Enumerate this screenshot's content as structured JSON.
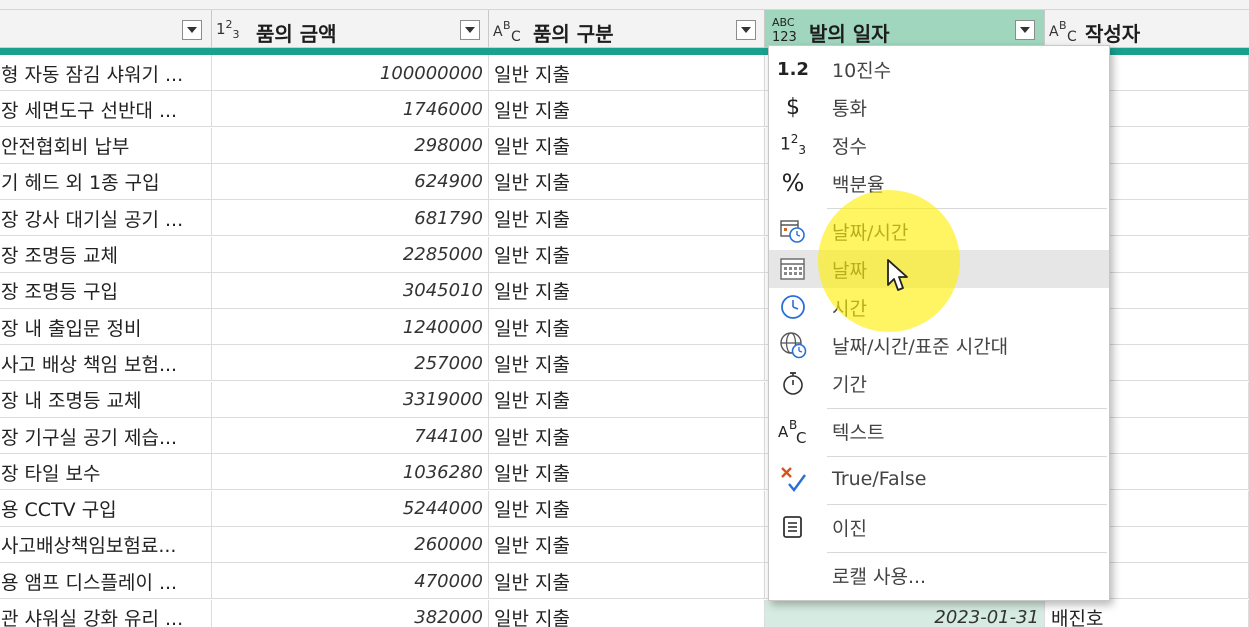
{
  "columns": {
    "amount": {
      "type_icon": "1²₃",
      "label": "품의 금액"
    },
    "category": {
      "type_icon": "ABC",
      "label": "품의 구분"
    },
    "order_date": {
      "type_icon": "ABC/123",
      "label": "발의 일자"
    },
    "author": {
      "type_icon": "ABC",
      "label": "작성자"
    }
  },
  "rows": [
    {
      "name": "형 자동 잠김 샤워기 ...",
      "amount": "100000000",
      "category": "일반 지출",
      "date": "",
      "author": ""
    },
    {
      "name": "장 세면도구 선반대 ...",
      "amount": "1746000",
      "category": "일반 지출",
      "date": "",
      "author": ""
    },
    {
      "name": "안전협회비 납부",
      "amount": "298000",
      "category": "일반 지출",
      "date": "",
      "author": ""
    },
    {
      "name": "기 헤드 외 1종 구입",
      "amount": "624900",
      "category": "일반 지출",
      "date": "",
      "author": ""
    },
    {
      "name": "장 강사 대기실 공기 ...",
      "amount": "681790",
      "category": "일반 지출",
      "date": "",
      "author": ""
    },
    {
      "name": "장 조명등 교체",
      "amount": "2285000",
      "category": "일반 지출",
      "date": "",
      "author": ""
    },
    {
      "name": "장 조명등 구입",
      "amount": "3045010",
      "category": "일반 지출",
      "date": "",
      "author": ""
    },
    {
      "name": "장 내 출입문 정비",
      "amount": "1240000",
      "category": "일반 지출",
      "date": "",
      "author": ""
    },
    {
      "name": " 사고 배상 책임 보험...",
      "amount": "257000",
      "category": "일반 지출",
      "date": "",
      "author": ""
    },
    {
      "name": "장 내 조명등 교체",
      "amount": "3319000",
      "category": "일반 지출",
      "date": "",
      "author": ""
    },
    {
      "name": "장 기구실 공기 제습...",
      "amount": "744100",
      "category": "일반 지출",
      "date": "",
      "author": ""
    },
    {
      "name": "장 타일 보수",
      "amount": "1036280",
      "category": "일반 지출",
      "date": "",
      "author": ""
    },
    {
      "name": "용 CCTV 구입",
      "amount": "5244000",
      "category": "일반 지출",
      "date": "",
      "author": ""
    },
    {
      "name": "사고배상책임보험료...",
      "amount": "260000",
      "category": "일반 지출",
      "date": "",
      "author": ""
    },
    {
      "name": "용 앰프 디스플레이 ...",
      "amount": "470000",
      "category": "일반 지출",
      "date": "",
      "author": ""
    },
    {
      "name": "관 샤워실 강화 유리 ...",
      "amount": "382000",
      "category": "일반 지출",
      "date": "2023-01-31",
      "author": "배진호"
    }
  ],
  "type_menu": {
    "items": [
      {
        "icon": "decimal-icon",
        "glyph": "1.2",
        "label": "10진수"
      },
      {
        "icon": "currency-icon",
        "glyph": "$",
        "label": "통화"
      },
      {
        "icon": "integer-icon",
        "glyph": "1²₃",
        "label": "정수"
      },
      {
        "icon": "percent-icon",
        "glyph": "%",
        "label": "백분율"
      },
      {
        "icon": "datetime-icon",
        "glyph": "",
        "label": "날짜/시간"
      },
      {
        "icon": "date-icon",
        "glyph": "",
        "label": "날짜"
      },
      {
        "icon": "time-icon",
        "glyph": "",
        "label": "시간"
      },
      {
        "icon": "datetimezone-icon",
        "glyph": "",
        "label": "날짜/시간/표준 시간대"
      },
      {
        "icon": "duration-icon",
        "glyph": "",
        "label": "기간"
      },
      {
        "icon": "text-icon",
        "glyph": "ABC",
        "label": "텍스트"
      },
      {
        "icon": "boolean-icon",
        "glyph": "",
        "label": "True/False"
      },
      {
        "icon": "binary-icon",
        "glyph": "",
        "label": "이진"
      },
      {
        "icon": "",
        "glyph": "",
        "label": "로캘 사용..."
      }
    ],
    "hovered_item": "날짜"
  },
  "colors": {
    "active_header": "#9fd6bd",
    "quality_bar": "#1aa08f",
    "highlight": "#ffee00",
    "menu_hover": "#e6e6e6"
  }
}
